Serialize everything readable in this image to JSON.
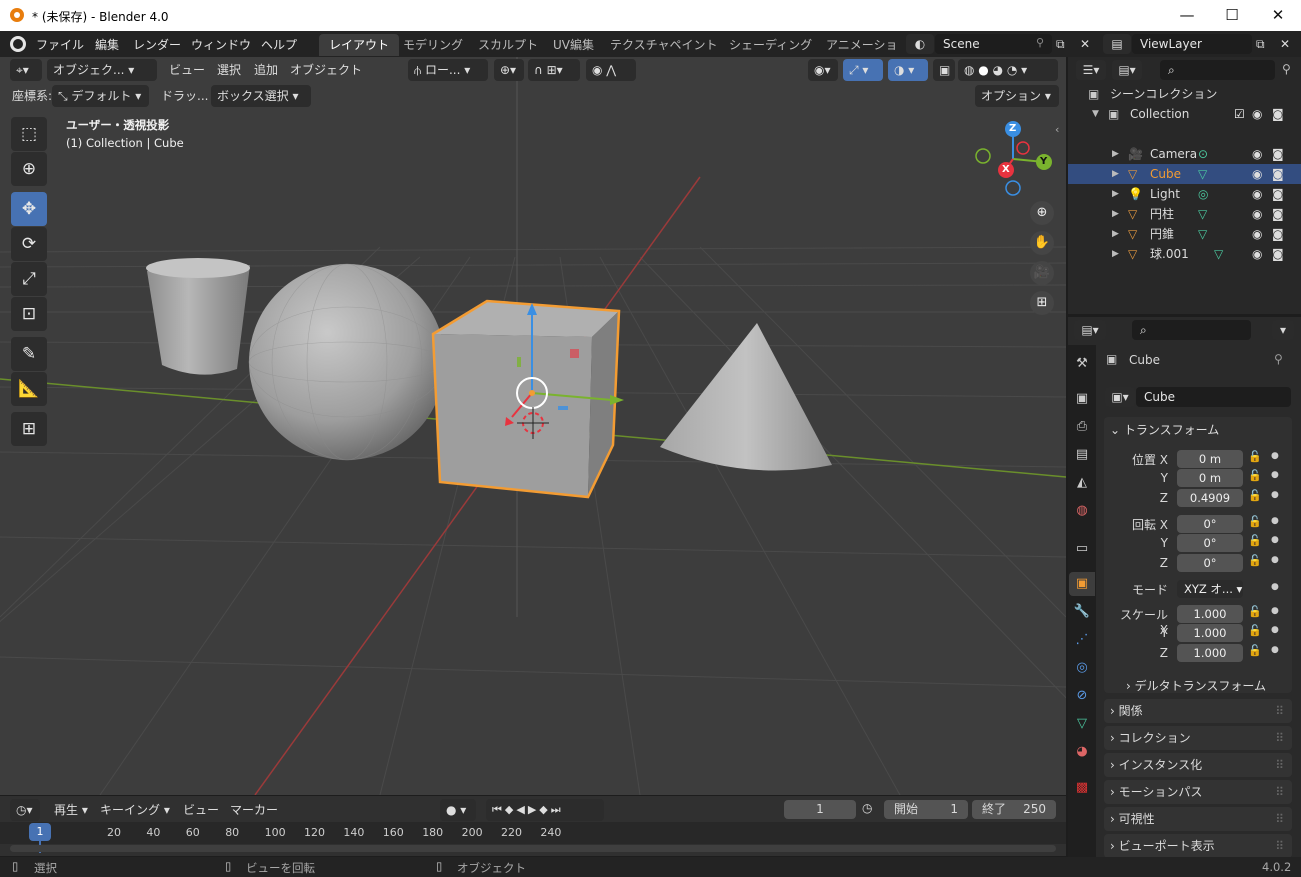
{
  "window": {
    "title": "* (未保存) - Blender 4.0",
    "minimize": "—",
    "maximize": "☐",
    "close": "✕"
  },
  "menubar": {
    "menus": [
      "ファイル",
      "編集",
      "レンダー",
      "ウィンドウ",
      "ヘルプ"
    ],
    "workspaces": [
      "レイアウト",
      "モデリング",
      "スカルプト",
      "UV編集",
      "テクスチャペイント",
      "シェーディング",
      "アニメーショ"
    ],
    "active_workspace": 0,
    "scene": "Scene",
    "view_layer": "ViewLayer"
  },
  "viewport_header": {
    "mode": "オブジェク...",
    "menus": [
      "ビュー",
      "選択",
      "追加",
      "オブジェクト"
    ],
    "transform_orientation": "ロー...",
    "coordinates_label": "座標系:",
    "coordinates_value": "デフォルト",
    "drag_label": "ドラッ...",
    "drag_value": "ボックス選択",
    "options": "オプション"
  },
  "viewport": {
    "view_name": "ユーザー・透視投影",
    "object_info": "(1) Collection | Cube",
    "gizmo": {
      "x": "X",
      "y": "Y",
      "z": "Z"
    }
  },
  "outliner": {
    "root": "シーンコレクション",
    "collection": "Collection",
    "items": [
      {
        "name": "Camera",
        "icon": "camera-icon",
        "color": "#e0963f",
        "selected": false
      },
      {
        "name": "Cube",
        "icon": "mesh-icon",
        "color": "#e0963f",
        "selected": true
      },
      {
        "name": "Light",
        "icon": "light-icon",
        "color": "#e0963f",
        "selected": false
      },
      {
        "name": "円柱",
        "icon": "mesh-icon",
        "color": "#e0963f",
        "selected": false
      },
      {
        "name": "円錐",
        "icon": "mesh-icon",
        "color": "#e0963f",
        "selected": false
      },
      {
        "name": "球.001",
        "icon": "mesh-icon",
        "color": "#e0963f",
        "selected": false
      }
    ]
  },
  "properties": {
    "object_name": "Cube",
    "object_field": "Cube",
    "transform_title": "トランスフォーム",
    "location": {
      "label": "位置 X",
      "x": "0 m",
      "y": "0 m",
      "z": "0.4909"
    },
    "rotation": {
      "label": "回転 X",
      "x": "0°",
      "y": "0°",
      "z": "0°"
    },
    "mode_label": "モード",
    "mode_value": "XYZ オ...",
    "scale": {
      "label": "スケール X",
      "x": "1.000",
      "y": "1.000",
      "z": "1.000"
    },
    "axis_y": "Y",
    "axis_z": "Z",
    "delta": "デルタトランスフォーム",
    "panels": [
      "関係",
      "コレクション",
      "インスタンス化",
      "モーションパス",
      "可視性",
      "ビューポート表示"
    ]
  },
  "timeline": {
    "play_menu": "再生",
    "keying_menu": "キーイング",
    "view_menu": "ビュー",
    "marker_menu": "マーカー",
    "current_frame": "1",
    "start_label": "開始",
    "start_value": "1",
    "end_label": "終了",
    "end_value": "250",
    "ticks": [
      "20",
      "40",
      "60",
      "80",
      "100",
      "120",
      "140",
      "160",
      "180",
      "200",
      "220",
      "240"
    ],
    "frame_indicator": "1"
  },
  "statusbar": {
    "select": "選択",
    "rotate_view": "ビューを回転",
    "object": "オブジェクト",
    "version": "4.0.2"
  },
  "colors": {
    "accent": "#4772b3",
    "selection": "#f39c33",
    "x_axis": "#e8333f",
    "y_axis": "#7ab32e",
    "z_axis": "#3a8fe3"
  }
}
